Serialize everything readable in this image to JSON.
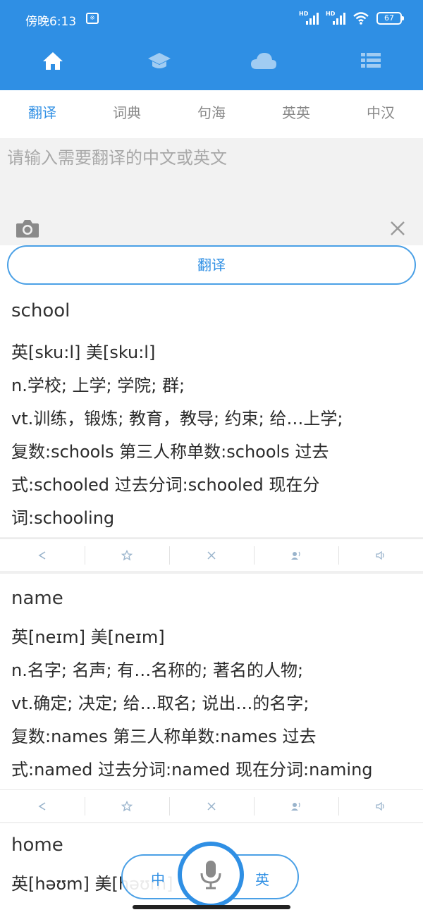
{
  "status": {
    "time": "傍晚6:13",
    "notif": "※",
    "hd1": "HD",
    "hd2": "HD",
    "battery": "67"
  },
  "nav": {
    "icons": [
      "home-icon",
      "graduation-cap-icon",
      "cloud-icon",
      "list-icon"
    ]
  },
  "tabs": [
    {
      "label": "翻译",
      "active": true
    },
    {
      "label": "词典",
      "active": false
    },
    {
      "label": "句海",
      "active": false
    },
    {
      "label": "英英",
      "active": false
    },
    {
      "label": "中汉",
      "active": false
    }
  ],
  "input": {
    "placeholder": "请输入需要翻译的中文或英文"
  },
  "translate_button": "翻译",
  "results": [
    {
      "word": "school",
      "lines": [
        "英[sku:l]  美[sku:l]",
        "n.学校; 上学; 学院; 群;",
        "vt.训练，锻炼; 教育，教导; 约束; 给…上学;",
        "复数:schools  第三人称单数:schools  过去",
        "式:schooled  过去分词:schooled  现在分",
        "词:schooling"
      ]
    },
    {
      "word": "name",
      "lines": [
        "英[neɪm]  美[neɪm]",
        "n.名字; 名声; 有…名称的; 著名的人物;",
        "vt.确定; 决定; 给…取名; 说出…的名字;",
        "复数:names  第三人称单数:names  过去",
        "式:named  过去分词:named  现在分词:naming"
      ]
    },
    {
      "word": "home",
      "lines": [
        "英[həʊm]  美[həʊm]"
      ]
    }
  ],
  "actions": [
    "share-icon",
    "star-icon",
    "close-icon",
    "speaker-person-icon",
    "volume-icon"
  ],
  "voice": {
    "zh": "中",
    "en": "英"
  }
}
